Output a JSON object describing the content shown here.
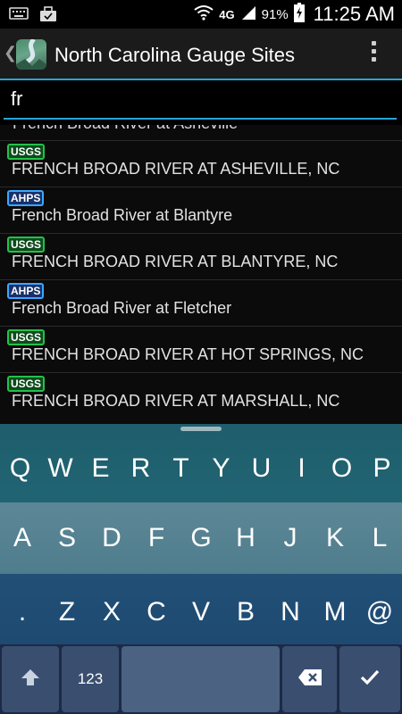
{
  "status_bar": {
    "left_icons": [
      "keyboard-icon",
      "briefcase-icon"
    ],
    "right_icons": [
      "wifi-icon",
      "lte-icon",
      "signal-icon",
      "battery-icon"
    ],
    "network_label": "4G",
    "battery_percent": "91%",
    "time": "11:25 AM"
  },
  "action_bar": {
    "title": "North Carolina Gauge Sites",
    "accent_color": "#2aa4d8"
  },
  "search": {
    "value": "fr"
  },
  "list": {
    "partial_item": "French Broad River at Asheville",
    "items": [
      {
        "badge": "USGS",
        "label": "FRENCH BROAD RIVER AT ASHEVILLE, NC"
      },
      {
        "badge": "AHPS",
        "label": "French Broad River at Blantyre"
      },
      {
        "badge": "USGS",
        "label": "FRENCH BROAD RIVER AT BLANTYRE, NC"
      },
      {
        "badge": "AHPS",
        "label": "French Broad River at Fletcher"
      },
      {
        "badge": "USGS",
        "label": "FRENCH BROAD RIVER AT HOT SPRINGS, NC"
      },
      {
        "badge": "USGS",
        "label": "FRENCH BROAD RIVER AT MARSHALL, NC"
      }
    ]
  },
  "keyboard": {
    "row1": [
      "Q",
      "W",
      "E",
      "R",
      "T",
      "Y",
      "U",
      "I",
      "O",
      "P"
    ],
    "row2": [
      "A",
      "S",
      "D",
      "F",
      "G",
      "H",
      "J",
      "K",
      "L"
    ],
    "row3": [
      ".",
      "Z",
      "X",
      "C",
      "V",
      "B",
      "N",
      "M",
      "@"
    ],
    "num_label": "123",
    "bottom_icons": [
      "shift-icon",
      "backspace-icon",
      "checkmark-icon"
    ]
  }
}
